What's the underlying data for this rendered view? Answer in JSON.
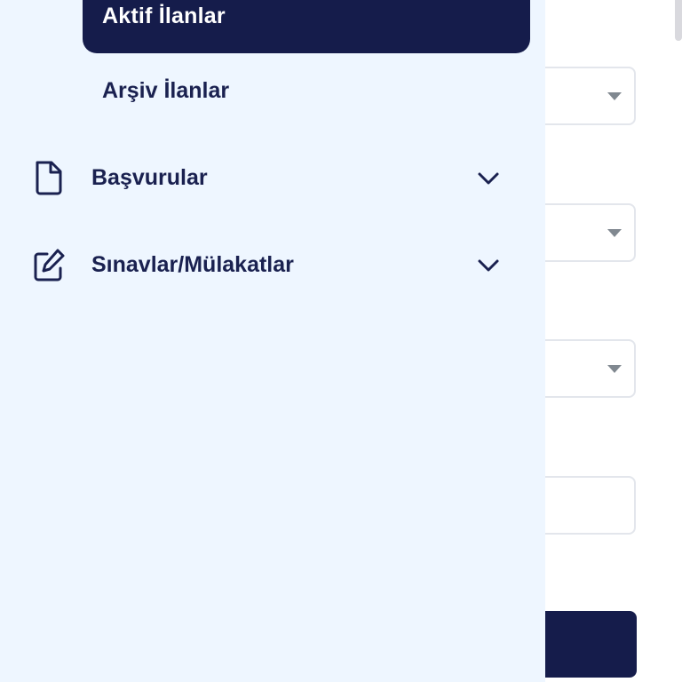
{
  "background_form": {
    "selects": [
      {
        "icon": "caret-down-icon"
      },
      {
        "icon": "caret-down-icon"
      },
      {
        "icon": "caret-down-icon"
      }
    ],
    "text_input": {
      "value": ""
    },
    "submit_button": {
      "label": ""
    }
  },
  "drawer": {
    "active_item": {
      "label": "Aktif İlanlar"
    },
    "sub_item": {
      "label": "Arşiv İlanlar"
    },
    "groups": [
      {
        "label": "Başvurular",
        "icon": "document-icon",
        "toggle_icon": "chevron-down-icon"
      },
      {
        "label": "Sınavlar/Mülakatlar",
        "icon": "edit-icon",
        "toggle_icon": "chevron-down-icon"
      }
    ]
  },
  "colors": {
    "drawer_bg": "#eef6ff",
    "active_bg": "#151c4b",
    "text": "#1a2150",
    "active_text": "#ffffff"
  }
}
